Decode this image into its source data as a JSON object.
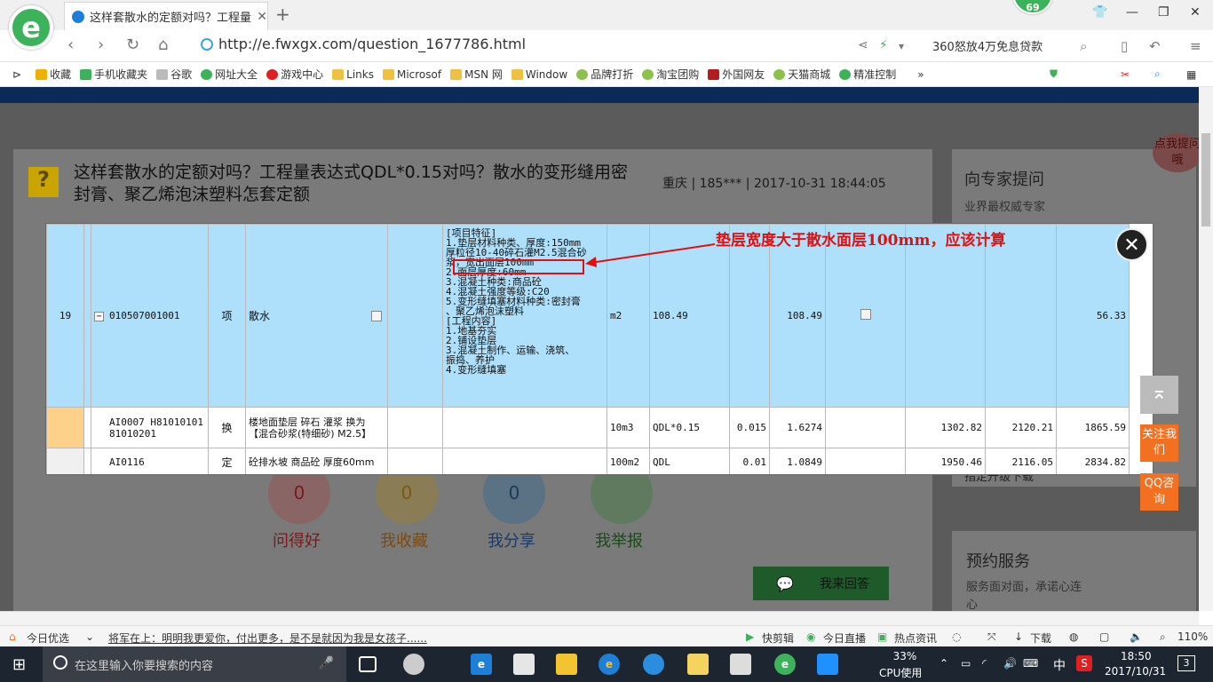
{
  "browser": {
    "badge": "69",
    "tab_title": "这样套散水的定额对吗？工程量表",
    "tab_close": "✕",
    "new_tab": "+",
    "url": "http://e.fwxgx.com/question_1677786.html",
    "ad_text": "360怒放4万免息贷款"
  },
  "bookmarks": [
    {
      "label": "收藏",
      "color": "#f0b000"
    },
    {
      "label": "手机收藏夹",
      "color": "#3cb35a"
    },
    {
      "label": "谷歌",
      "color": "#bbbbbb"
    },
    {
      "label": "网址大全",
      "color": "#3cb35a"
    },
    {
      "label": "游戏中心",
      "color": "#e02020"
    },
    {
      "label": "Links",
      "color": "#f0c040"
    },
    {
      "label": "Microsof",
      "color": "#f0c040"
    },
    {
      "label": "MSN 网",
      "color": "#f0c040"
    },
    {
      "label": "Window",
      "color": "#f0c040"
    },
    {
      "label": "品牌打折",
      "color": "#8bc34a"
    },
    {
      "label": "淘宝团购",
      "color": "#8bc34a"
    },
    {
      "label": "外国网友",
      "color": "#b71c1c"
    },
    {
      "label": "天猫商城",
      "color": "#8bc34a"
    },
    {
      "label": "精准控制",
      "color": "#3cb35a"
    }
  ],
  "question": {
    "title": "这样套散水的定额对吗？工程量表达式QDL*0.15对吗？散水的变形缝用密封膏、聚乙烯泡沫塑料怎套定额",
    "meta": "重庆 | 185*** | 2017-10-31 18:44:05",
    "stats": [
      {
        "value": "0",
        "label": "问得好"
      },
      {
        "value": "0",
        "label": "我收藏"
      },
      {
        "value": "0",
        "label": "我分享"
      },
      {
        "value": "",
        "label": "我举报"
      }
    ],
    "answer_button": "我来回答"
  },
  "sidebar": {
    "ask_expert": "向专家提问",
    "ask_sub": "业界最权威专家",
    "bubble": "点我提问哦",
    "upgrade_text": "指定升级下载",
    "booking_title": "预约服务",
    "booking_sub": "服务面对面，承诺心连心"
  },
  "modal": {
    "callout": "垫层宽度大于散水面层100mm，应该计算",
    "row1": {
      "seq": "19",
      "code": "010507001001",
      "type": "项",
      "name": "散水",
      "features": [
        "[项目特征]",
        "1.垫层材料种类、厚度:150mm",
        "厚粒径10-40碎石灌M2.5混合砂",
        "浆，宽出面层100mm",
        "2.面层厚度:60mm",
        "3.混凝土种类:商品砼",
        "4.混凝土强度等级:C20",
        "5.变形缝填塞材料种类:密封膏",
        "、聚乙烯泡沫塑料",
        "[工程内容]",
        "1.地基夯实",
        "2.铺设垫层",
        "3.混凝土制作、运输、浇筑、",
        "振捣、养护",
        "4.变形缝填塞"
      ],
      "unit": "m2",
      "expr": "108.49",
      "qty": "108.49",
      "total": "56.33"
    },
    "row2": {
      "code": "AI0007 H81010101 81010201",
      "type": "换",
      "name": "楼地面垫层 碎石 灌浆 换为【混合砂浆(特细砂) M2.5】",
      "unit": "10m3",
      "expr": "QDL*0.15",
      "coef": "0.015",
      "qty": "1.6274",
      "p1": "1302.82",
      "p2": "2120.21",
      "p3": "1865.59"
    },
    "row3": {
      "code": "AI0116",
      "type": "定",
      "name": "砼排水坡 商品砼 厚度60mm",
      "unit": "100m2",
      "expr": "QDL",
      "coef": "0.01",
      "qty": "1.0849",
      "p1": "1950.46",
      "p2": "2116.05",
      "p3": "2834.82"
    }
  },
  "float_tools": {
    "follow": "关注我们",
    "qq": "QQ咨询"
  },
  "statusbar": {
    "today": "今日优选",
    "news": "将军在上：明明我更爱你，付出更多，是不是就因为我是女孩子......",
    "edit": "快剪辑",
    "live": "今日直播",
    "hot": "热点资讯",
    "download": "下载",
    "zoom": "110%"
  },
  "taskbar": {
    "search_placeholder": "在这里输入你要搜索的内容",
    "cpu_pct": "33%",
    "cpu_label": "CPU使用",
    "ime": "中",
    "time": "18:50",
    "date": "2017/10/31",
    "notif": "3"
  }
}
